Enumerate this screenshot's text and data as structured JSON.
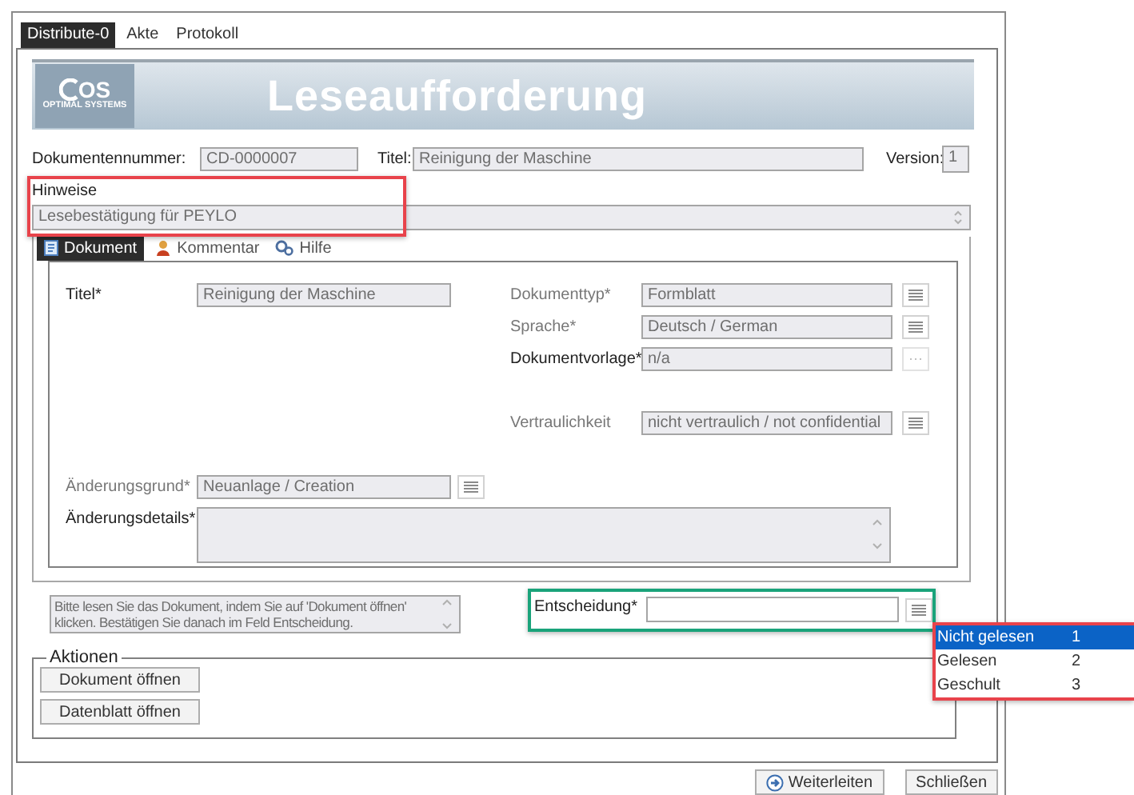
{
  "window_tabs": [
    {
      "label": "Distribute-0",
      "selected": true
    },
    {
      "label": "Akte",
      "selected": false
    },
    {
      "label": "Protokoll",
      "selected": false
    }
  ],
  "banner": {
    "logo_text": "OS",
    "logo_subtitle": "OPTIMAL SYSTEMS",
    "title": "Leseaufforderung"
  },
  "header": {
    "document_number": {
      "label": "Dokumentennummer:",
      "value": "CD-0000007"
    },
    "title": {
      "label": "Titel:",
      "value": "Reinigung der Maschine"
    },
    "version": {
      "label": "Version:",
      "value": "1"
    }
  },
  "notes": {
    "label": "Hinweise",
    "value": "Lesebestätigung für PEYLO",
    "highlighted": true
  },
  "document_tabs": [
    {
      "label": "Dokument",
      "selected": true
    },
    {
      "label": "Kommentar",
      "selected": false
    },
    {
      "label": "Hilfe",
      "selected": false
    }
  ],
  "form": {
    "title": {
      "label": "Titel*",
      "value": "Reinigung der Maschine",
      "editable": true
    },
    "right_fields": [
      {
        "label": "Dokumenttyp*",
        "value": "Formblatt",
        "editable": false,
        "kind": "list"
      },
      {
        "label": "Sprache*",
        "value": "Deutsch / German",
        "editable": false,
        "kind": "list"
      },
      {
        "label": "Dokumentvorlage*",
        "value": "n/a",
        "editable": true,
        "kind": "ellipsis"
      },
      {
        "label": "Vertraulichkeit",
        "value": "nicht vertraulich / not confidential",
        "editable": false,
        "kind": "list"
      }
    ],
    "change_reason": {
      "label": "Änderungsgrund*",
      "value": "Neuanlage / Creation",
      "editable": false,
      "kind": "list"
    },
    "change_details": {
      "label": "Änderungsdetails*",
      "editable": true
    }
  },
  "info_text": "Bitte lesen Sie das Dokument, indem Sie auf 'Dokument öffnen' klicken. Bestätigen Sie danach im Feld Entscheidung.",
  "decision": {
    "label": "Entscheidung*",
    "highlighted": true,
    "dropdown_open": true,
    "options": [
      {
        "label": "Nicht gelesen",
        "number": "1",
        "selected": true
      },
      {
        "label": "Gelesen",
        "number": "2",
        "selected": false
      },
      {
        "label": "Geschult",
        "number": "3",
        "selected": false
      }
    ]
  },
  "actions": {
    "title": "Aktionen",
    "buttons": [
      "Dokument öffnen",
      "Datenblatt öffnen"
    ]
  },
  "footer_buttons": [
    {
      "label": "Weiterleiten",
      "kind": "forward"
    },
    {
      "label": "Schließen",
      "kind": "plain"
    }
  ]
}
